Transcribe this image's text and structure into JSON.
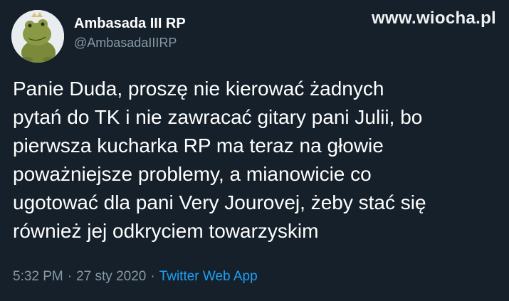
{
  "watermark": "www.wiocha.pl",
  "author": {
    "display_name": "Ambasada III RP",
    "handle": "@AmbasadaIIIRP",
    "avatar_icon": "frog-plush-avatar"
  },
  "tweet": {
    "lines": [
      "Panie Duda, proszę nie kierować żadnych",
      "pytań do TK i nie zawracać gitary pani Julii, bo",
      "pierwsza kucharka RP ma teraz na głowie",
      "poważniejsze problemy, a mianowicie co",
      "ugotować dla pani Very Jourovej, żeby stać się",
      "również jej odkryciem towarzyskim"
    ]
  },
  "meta": {
    "time": "5:32 PM",
    "separator": "·",
    "date": "27 sty 2020",
    "source": "Twitter Web App"
  },
  "colors": {
    "background": "#15202b",
    "text": "#ffffff",
    "muted": "#8899a6",
    "link": "#1da1f2"
  }
}
